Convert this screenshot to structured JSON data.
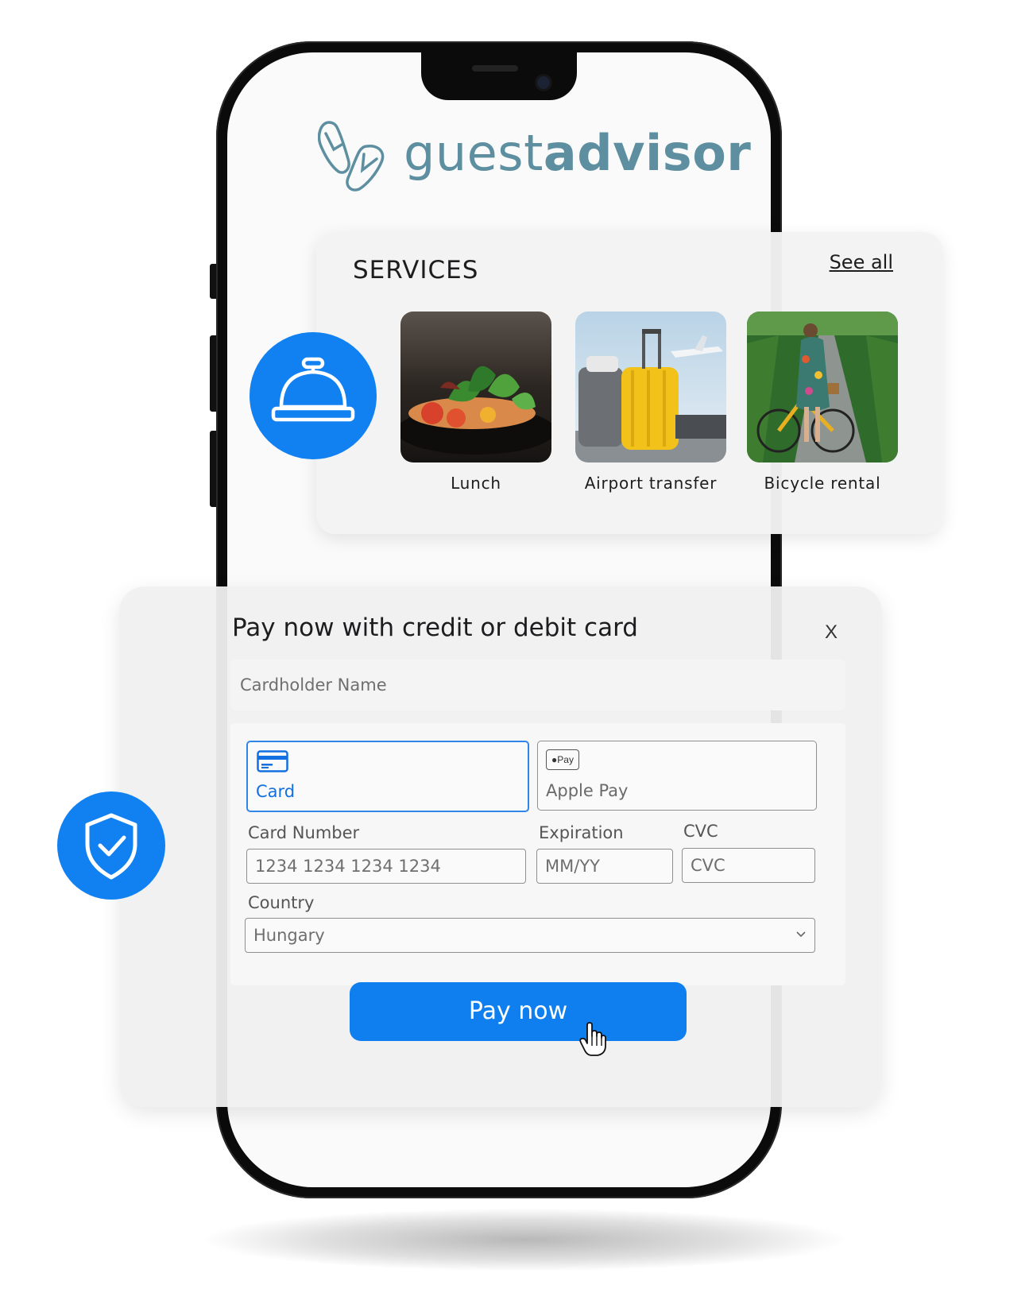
{
  "brand": {
    "name_light": "guest",
    "name_bold": "advisor",
    "color": "#5d8fa0"
  },
  "services": {
    "title": "SERVICES",
    "see_all": "See all",
    "items": [
      {
        "label": "Lunch"
      },
      {
        "label": "Airport transfer"
      },
      {
        "label": "Bicycle rental"
      }
    ]
  },
  "payment": {
    "title": "Pay now with credit or debit card",
    "close": "X",
    "cardholder_placeholder": "Cardholder Name",
    "methods": [
      {
        "label": "Card",
        "icon": "credit-card-icon",
        "selected": true
      },
      {
        "label": "Apple Pay",
        "icon": "apple-pay-icon",
        "badge": "Pay",
        "selected": false
      }
    ],
    "fields": {
      "card_number_label": "Card Number",
      "card_number_placeholder": "1234 1234 1234 1234",
      "expiration_label": "Expiration",
      "expiration_placeholder": "MM/YY",
      "cvc_label": "CVC",
      "cvc_placeholder": "CVC",
      "country_label": "Country",
      "country_value": "Hungary"
    },
    "pay_button": "Pay now"
  },
  "colors": {
    "accent": "#1181f2",
    "button": "#0f7ff0",
    "card_selected": "#2f86e8"
  },
  "icons": [
    "service-bell-icon",
    "shield-check-icon",
    "flip-flops-icon",
    "hand-cursor-icon",
    "chevron-down-icon"
  ]
}
